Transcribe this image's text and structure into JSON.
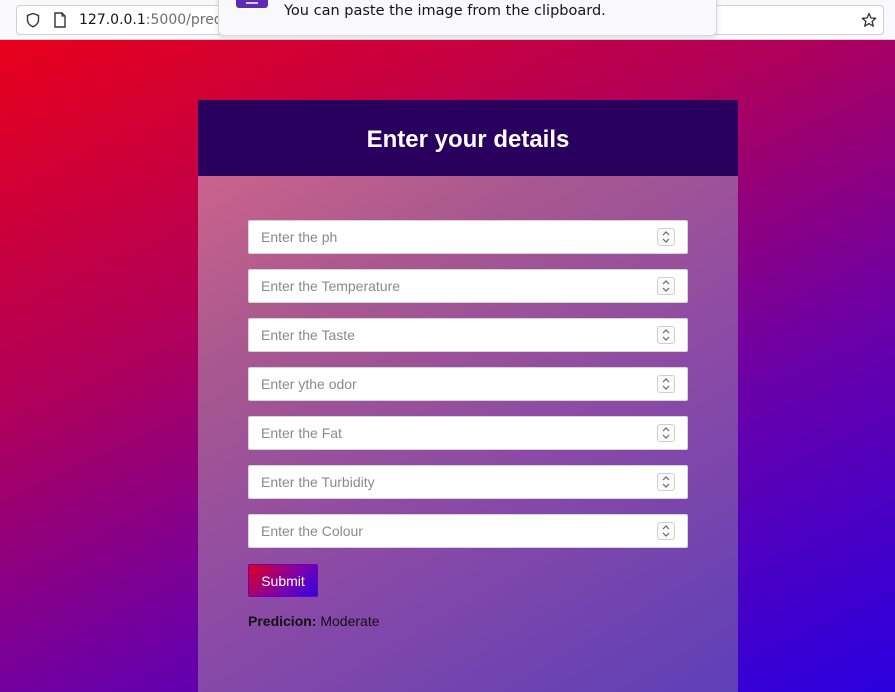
{
  "browser": {
    "url_host": "127.0.0.1",
    "url_rest": ":5000/pred"
  },
  "notification": {
    "text": "You can paste the image from the clipboard."
  },
  "form": {
    "title": "Enter your details",
    "fields": [
      {
        "placeholder": "Enter the ph",
        "value": ""
      },
      {
        "placeholder": "Enter the Temperature",
        "value": ""
      },
      {
        "placeholder": "Enter the Taste",
        "value": ""
      },
      {
        "placeholder": "Enter ythe odor",
        "value": ""
      },
      {
        "placeholder": "Enter the Fat",
        "value": ""
      },
      {
        "placeholder": "Enter the Turbidity",
        "value": ""
      },
      {
        "placeholder": "Enter the Colour",
        "value": ""
      }
    ],
    "submit_label": "Submit",
    "prediction_label": "Predicion:",
    "prediction_value": "Moderate"
  },
  "colors": {
    "header_bg": "#2a005e",
    "page_gradient_start": "#e8001a",
    "page_gradient_end": "#2a00e0"
  }
}
